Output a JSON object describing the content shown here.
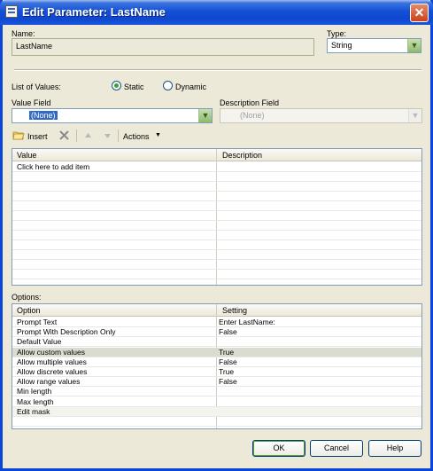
{
  "window": {
    "title": "Edit Parameter: LastName",
    "close_glyph": "✕"
  },
  "name": {
    "label": "Name:",
    "value": "LastName"
  },
  "type": {
    "label": "Type:",
    "value": "String"
  },
  "list_of_values": {
    "label": "List of Values:",
    "static_label": "Static",
    "dynamic_label": "Dynamic",
    "selected": "Static"
  },
  "value_field": {
    "label": "Value Field",
    "value": "(None)"
  },
  "description_field": {
    "label": "Description Field",
    "value": "(None)"
  },
  "toolbar": {
    "insert_label": "Insert",
    "actions_label": "Actions"
  },
  "values_grid": {
    "columns": [
      "Value",
      "Description"
    ],
    "rows": [
      [
        "Click here to add item",
        ""
      ]
    ],
    "empty_rows": 12
  },
  "options": {
    "label": "Options:",
    "columns": [
      "Option",
      "Setting"
    ],
    "rows": [
      [
        "Prompt Text",
        "Enter LastName:"
      ],
      [
        "Prompt With Description Only",
        "False"
      ],
      [
        "Default Value",
        ""
      ],
      [
        "Allow custom values",
        "True"
      ],
      [
        "Allow multiple values",
        "False"
      ],
      [
        "Allow discrete values",
        "True"
      ],
      [
        "Allow range values",
        "False"
      ],
      [
        "Min length",
        ""
      ],
      [
        "Max length",
        ""
      ],
      [
        "Edit mask",
        ""
      ]
    ]
  },
  "buttons": {
    "ok": "OK",
    "cancel": "Cancel",
    "help": "Help"
  },
  "colors": {
    "title_bar": "#0f47cf",
    "dialog_bg": "#ece9d8",
    "accent_green": "#5e9a3c"
  },
  "icons": [
    "window-icon",
    "close-icon",
    "insert-folder-icon",
    "delete-x-icon",
    "arrow-up-icon",
    "arrow-down-icon",
    "dropdown-arrow-icon"
  ]
}
